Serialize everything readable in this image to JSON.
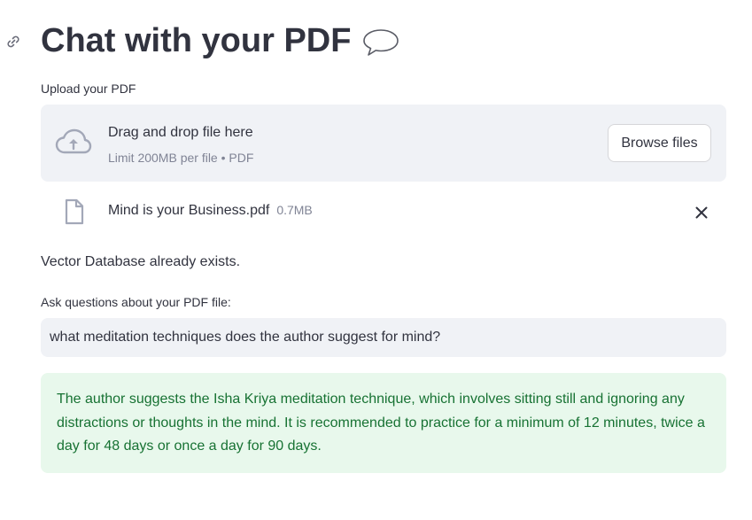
{
  "header": {
    "title": "Chat with your PDF",
    "emoji": "speech-balloon-icon",
    "anchor_icon": "link-icon"
  },
  "uploader": {
    "label": "Upload your PDF",
    "drop_title": "Drag and drop file here",
    "drop_hint": "Limit 200MB per file • PDF",
    "browse_label": "Browse files",
    "icon": "cloud-upload-icon"
  },
  "uploaded_file": {
    "name": "Mind is your Business.pdf",
    "size": "0.7MB",
    "icon": "file-icon",
    "remove_icon": "close-icon"
  },
  "status": {
    "message": "Vector Database already exists."
  },
  "question": {
    "label": "Ask questions about your PDF file:",
    "value": "what meditation techniques does the author suggest for mind?"
  },
  "answer": {
    "text": "The author suggests the Isha Kriya meditation technique, which involves sitting still and ignoring any distractions or thoughts in the mind. It is recommended to practice for a minimum of 12 minutes, twice a day for 48 days or once a day for 90 days."
  },
  "colors": {
    "text": "#31333f",
    "muted": "#808495",
    "panel_bg": "#f0f2f6",
    "success_bg": "#e8f8ec",
    "success_text": "#177233"
  }
}
